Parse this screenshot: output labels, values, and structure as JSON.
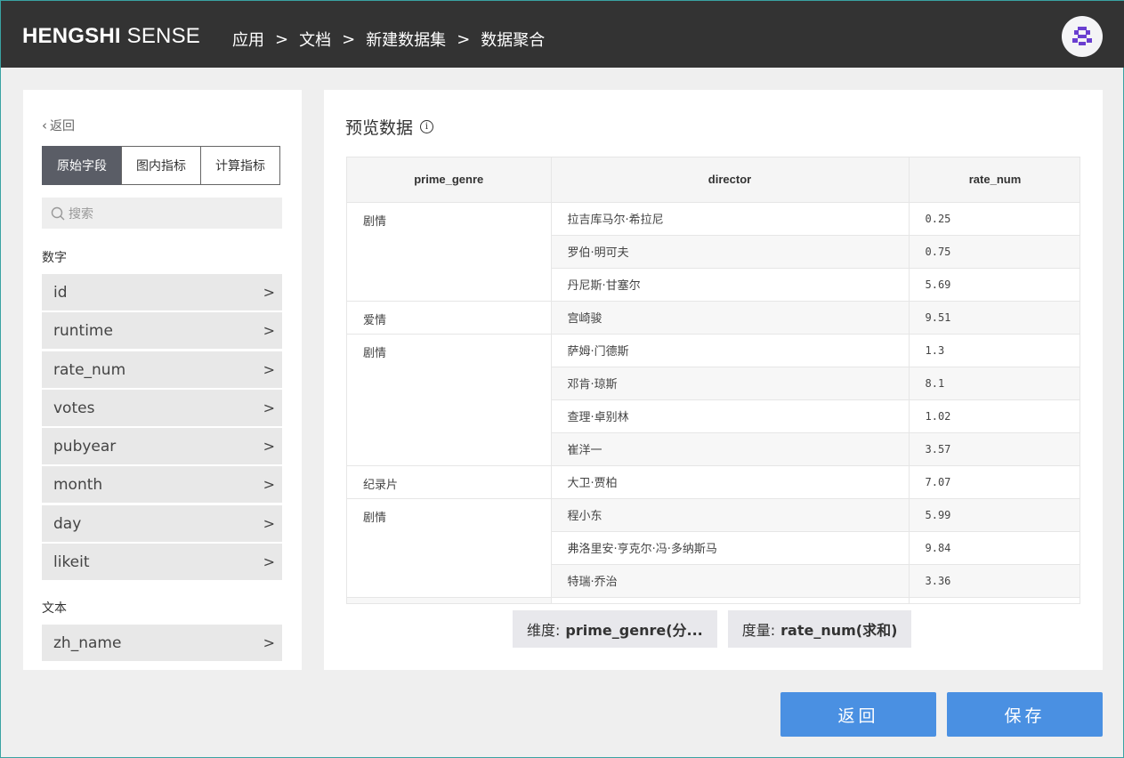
{
  "header": {
    "brand_bold": "HENGSHI",
    "brand_light": " SENSE",
    "breadcrumbs": [
      "应用",
      "文档",
      "新建数据集",
      "数据聚合"
    ],
    "separator": ">"
  },
  "sidebar": {
    "back_label": "返回",
    "tabs": [
      "原始字段",
      "图内指标",
      "计算指标"
    ],
    "active_tab": "原始字段",
    "search_placeholder": "搜索",
    "number_section": "数字",
    "number_fields": [
      "id",
      "runtime",
      "rate_num",
      "votes",
      "pubyear",
      "month",
      "day",
      "likeit"
    ],
    "text_section": "文本",
    "text_fields": [
      "zh_name"
    ]
  },
  "preview": {
    "title": "预览数据",
    "columns": [
      "prime_genre",
      "director",
      "rate_num"
    ],
    "groups": [
      {
        "genre": "剧情",
        "rows": [
          [
            "拉吉库马尔·希拉尼",
            "0.25"
          ],
          [
            "罗伯·明可夫",
            "0.75"
          ],
          [
            "丹尼斯·甘塞尔",
            "5.69"
          ]
        ]
      },
      {
        "genre": "爱情",
        "rows": [
          [
            "宫崎骏",
            "9.51"
          ]
        ]
      },
      {
        "genre": "剧情",
        "rows": [
          [
            "萨姆·门德斯",
            "1.3"
          ],
          [
            "邓肯·琼斯",
            "8.1"
          ],
          [
            "查理·卓别林",
            "1.02"
          ],
          [
            "崔洋一",
            "3.57"
          ]
        ]
      },
      {
        "genre": "纪录片",
        "rows": [
          [
            "大卫·贾柏",
            "7.07"
          ]
        ]
      },
      {
        "genre": "剧情",
        "rows": [
          [
            "程小东",
            "5.99"
          ],
          [
            "弗洛里安·亨克尔·冯·多纳斯马",
            "9.84"
          ],
          [
            "特瑞·乔治",
            "3.36"
          ]
        ]
      }
    ],
    "dimension_key": "维度:",
    "dimension_value": "prime_genre(分...",
    "measure_key": "度量:",
    "measure_value": "rate_num(求和)"
  },
  "actions": {
    "back_button": "返回",
    "save_button": "保存"
  },
  "colors": {
    "topbar": "#333333",
    "accent_button": "#4a90e2",
    "active_tab": "#5a5d66"
  }
}
